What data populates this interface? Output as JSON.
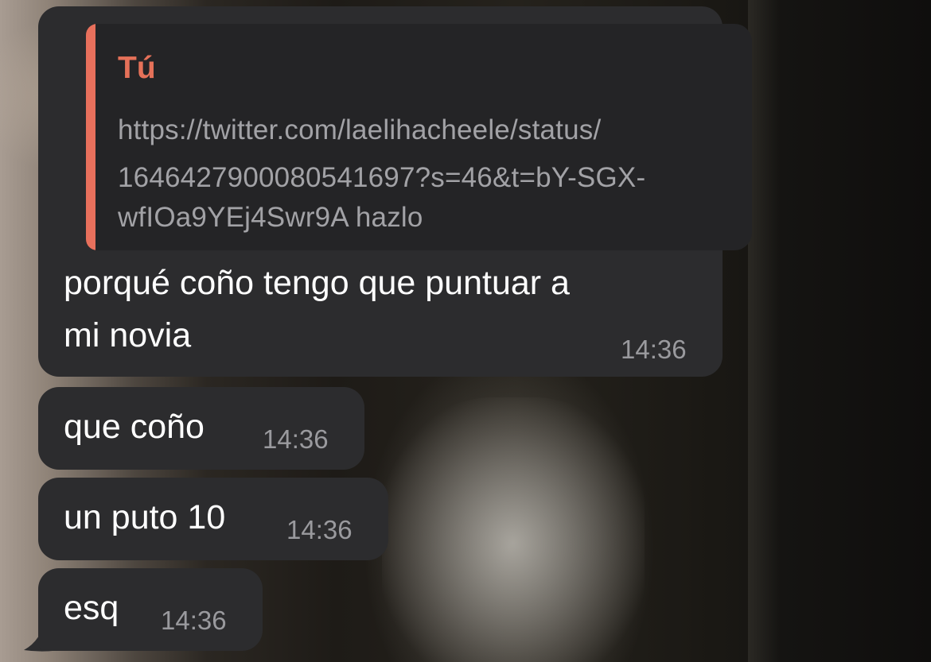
{
  "messages": [
    {
      "reply": {
        "author": "Tú",
        "lines": [
          "https://twitter.com/laelihacheele/status/",
          "1646427900080541697?s=46&t=bY-SGX-",
          "wfIOa9YEj4Swr9A hazlo"
        ]
      },
      "lines": [
        "porqué coño tengo que puntuar a",
        "mi novia"
      ],
      "time": "14:36"
    },
    {
      "text": "que coño",
      "time": "14:36"
    },
    {
      "text": "un puto 10",
      "time": "14:36"
    },
    {
      "text": "esq",
      "time": "14:36"
    }
  ],
  "colors": {
    "bubble": "#2c2c2e",
    "quote_background": "#242426",
    "quote_accent": "#e8705c",
    "author": "#e57159",
    "timestamp": "#9a9a9e"
  }
}
